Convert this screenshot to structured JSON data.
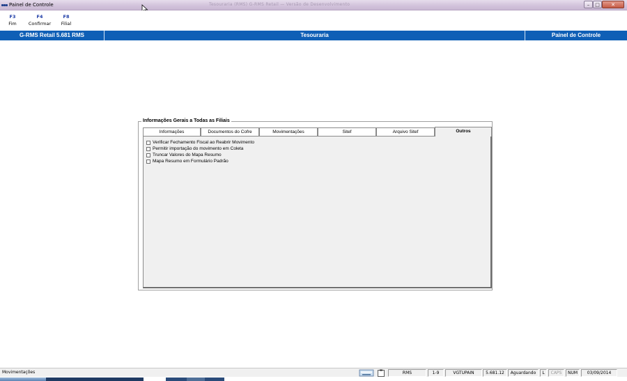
{
  "window": {
    "title": "Painel de Controle",
    "title_obscured": "Tesouraria (RMS) G-RMS Retail — Versão de Desenvolvimento"
  },
  "function_keys": [
    {
      "key": "F3",
      "label": "Fim"
    },
    {
      "key": "F4",
      "label": "Confirmar"
    },
    {
      "key": "F8",
      "label": "Filial"
    }
  ],
  "header": {
    "left": "G-RMS Retail 5.681 RMS",
    "center": "Tesouraria",
    "right": "Painel de Controle"
  },
  "group": {
    "title": "Informações Gerais a Todas as Filiais"
  },
  "tabs": [
    {
      "label": "Informações",
      "active": false
    },
    {
      "label": "Documentos do Cofre",
      "active": false
    },
    {
      "label": "Movimentações",
      "active": false
    },
    {
      "label": "Sitef",
      "active": false
    },
    {
      "label": "Arquivo Sitef",
      "active": false
    },
    {
      "label": "Outros",
      "active": true
    }
  ],
  "options": [
    {
      "label": "Verificar Fechamento Fiscal ao Reabrir Movimento",
      "checked": false
    },
    {
      "label": "Permitir importação do movimento em Coleta",
      "checked": false
    },
    {
      "label": "Truncar Valores do Mapa Resumo",
      "checked": false
    },
    {
      "label": "Mapa Resumo em Formulário Padrão",
      "checked": false
    }
  ],
  "statusbar": {
    "message": "Movimentações",
    "cells": [
      "RMS",
      "1-9",
      "VGTUPAIN",
      "5.681.12",
      "Aguardando",
      "L",
      "CAPS",
      "NUM",
      "03/09/2014"
    ],
    "icons": [
      "keyboard-icon",
      "clipboard-icon"
    ]
  },
  "colors": {
    "accent": "#0f5fb6",
    "fkey": "#1b3aa5",
    "titlebar": "#d3c4dc",
    "panel": "#f0f0f0"
  }
}
